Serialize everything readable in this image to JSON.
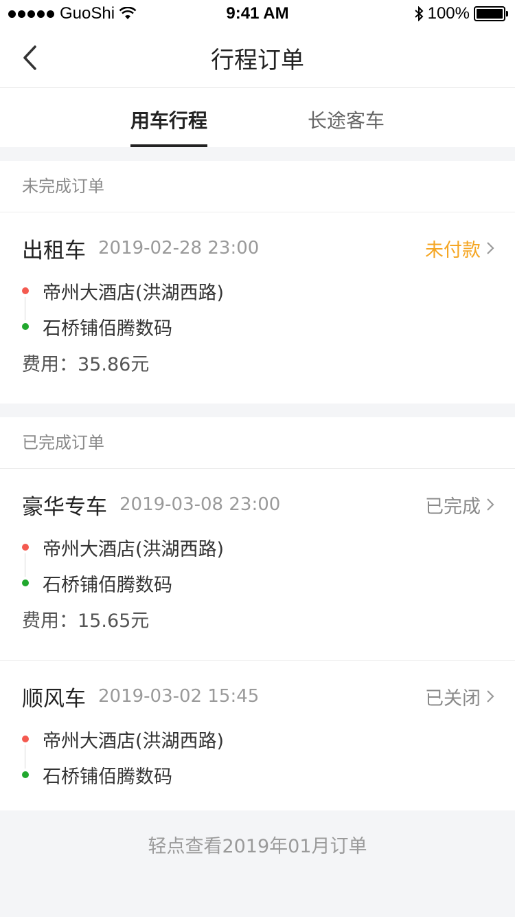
{
  "status_bar": {
    "carrier": "GuoShi",
    "time": "9:41 AM",
    "battery": "100%"
  },
  "nav": {
    "title": "行程订单",
    "back_icon": "chevron-left-icon"
  },
  "tabs": [
    {
      "label": "用车行程",
      "active": true
    },
    {
      "label": "长途客车",
      "active": false
    }
  ],
  "sections": [
    {
      "title": "未完成订单",
      "orders": [
        {
          "type": "出租车",
          "time": "2019-02-28 23:00",
          "status": "未付款",
          "from": "帝州大酒店(洪湖西路)",
          "to": "石桥铺佰腾数码",
          "fee": "费用：35.86元"
        }
      ]
    },
    {
      "title": "已完成订单",
      "orders": [
        {
          "type": "豪华专车",
          "time": "2019-03-08 23:00",
          "status": "已完成",
          "from": "帝州大酒店(洪湖西路)",
          "to": "石桥铺佰腾数码",
          "fee": "费用：15.65元"
        },
        {
          "type": "顺风车",
          "time": "2019-03-02 15:45",
          "status": "已关闭",
          "from": "帝州大酒店(洪湖西路)",
          "to": "石桥铺佰腾数码"
        }
      ]
    }
  ],
  "footer": {
    "link": "轻点查看2019年01月订单"
  },
  "colors": {
    "unpaid": "#f5a623",
    "start_dot": "#f45a50",
    "end_dot": "#21a82e"
  }
}
